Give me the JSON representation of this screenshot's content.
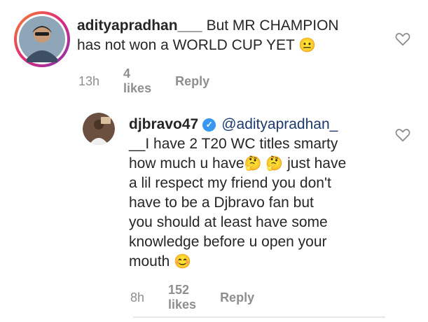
{
  "comments": [
    {
      "username": "adityapradhan___",
      "text_line1": "But MR CHAMPION",
      "text_line2": "has not won a WORLD CUP YET",
      "emoji": "😐",
      "time": "13h",
      "likes": "4 likes",
      "reply": "Reply"
    },
    {
      "username": "djbravo47",
      "mention": "@adityapradhan_",
      "lines": [
        "__I have 2 T20 WC titles smarty",
        "how much u have",
        "just have",
        "a lil respect my friend you don't",
        "have to be a Djbravo fan but",
        "you should at least have some",
        "knowledge before u open your",
        "mouth"
      ],
      "emoji_think": "🤔",
      "emoji_smile": "😊",
      "time": "8h",
      "likes": "152 likes",
      "reply": "Reply"
    }
  ],
  "icons": {
    "like": "heart-outline-icon",
    "verified": "verified-badge-icon"
  },
  "colors": {
    "verified": "#3897f0",
    "meta": "#8e8e8e",
    "story_ring": "#e1306c"
  }
}
